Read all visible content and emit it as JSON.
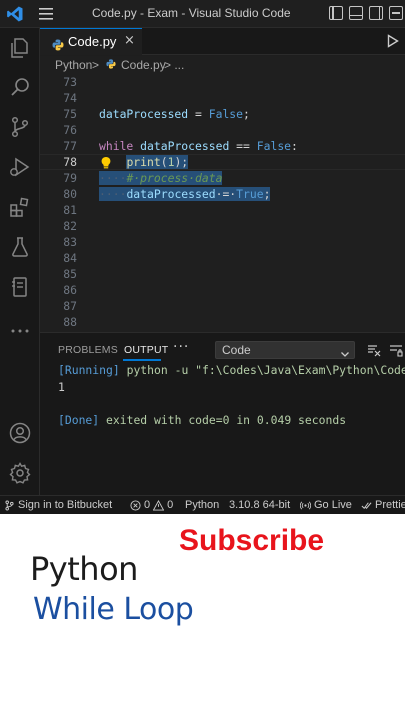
{
  "window": {
    "title": "Code.py - Exam - Visual Studio Code"
  },
  "tabs": [
    {
      "label": "Code.py",
      "close": "×"
    }
  ],
  "breadcrumb": {
    "folder": "Python",
    "sep1": ">",
    "file": "Code.py",
    "sep2": "> ..."
  },
  "editor": {
    "lines": [
      {
        "num": "73"
      },
      {
        "num": "74"
      },
      {
        "num": "75",
        "tokens": [
          {
            "t": "dataProcessed",
            "c": "id"
          },
          {
            "t": " = ",
            "c": "op"
          },
          {
            "t": "False",
            "c": "cst"
          },
          {
            "t": ";",
            "c": "op"
          }
        ]
      },
      {
        "num": "76"
      },
      {
        "num": "77",
        "tokens": [
          {
            "t": "while",
            "c": "kw"
          },
          {
            "t": " ",
            "c": "op"
          },
          {
            "t": "dataProcessed",
            "c": "id"
          },
          {
            "t": " == ",
            "c": "op"
          },
          {
            "t": "False",
            "c": "cst"
          },
          {
            "t": ":",
            "c": "op"
          }
        ]
      },
      {
        "num": "78",
        "tokens": [
          {
            "t": "    ",
            "c": "op"
          },
          {
            "t": "print",
            "c": "fn",
            "sel": true
          },
          {
            "t": "(",
            "c": "op",
            "sel": true
          },
          {
            "t": "1",
            "c": "num",
            "sel": true
          },
          {
            "t": ");",
            "c": "op",
            "sel": true
          }
        ]
      },
      {
        "num": "79",
        "tokens": [
          {
            "t": "····",
            "c": "ws",
            "sel": true
          },
          {
            "t": "#·process·data",
            "c": "cmt",
            "sel": true
          }
        ]
      },
      {
        "num": "80",
        "tokens": [
          {
            "t": "····",
            "c": "ws",
            "sel": true
          },
          {
            "t": "dataProcessed",
            "c": "id",
            "sel": true
          },
          {
            "t": "·=·",
            "c": "op",
            "sel": true
          },
          {
            "t": "True",
            "c": "cst",
            "sel": true
          },
          {
            "t": ";",
            "c": "op",
            "sel": true
          }
        ]
      },
      {
        "num": "81"
      },
      {
        "num": "82"
      },
      {
        "num": "83"
      },
      {
        "num": "84"
      },
      {
        "num": "85"
      },
      {
        "num": "86"
      },
      {
        "num": "87"
      },
      {
        "num": "88"
      }
    ]
  },
  "panel": {
    "tabs": [
      "PROBLEMS",
      "OUTPUT"
    ],
    "more": "···",
    "channel": "Code",
    "output": {
      "running_tag": "[Running]",
      "running_cmd": " python -u ",
      "running_path": "\"f:\\Codes\\Java\\Exam\\Python\\Code.p",
      "result": "1",
      "done_tag": "[Done]",
      "done_text1": " exited with ",
      "done_code": "code=0",
      "done_text2": " in ",
      "done_time": "0.049",
      "done_text3": " seconds"
    }
  },
  "statusbar": {
    "bitbucket": "Sign in to Bitbucket",
    "errors": "0",
    "warnings": "0",
    "language": "Python",
    "interpreter": "3.10.8 64-bit",
    "golive": "Go Live",
    "prettier": "Prettie"
  },
  "promo": {
    "subscribe": "Subscribe",
    "title_line1": "Python",
    "title_line2": "While Loop"
  },
  "colors": {
    "accent": "#0078d4",
    "subscribe_red": "#e8141c",
    "title_blue": "#1b4fa0"
  }
}
